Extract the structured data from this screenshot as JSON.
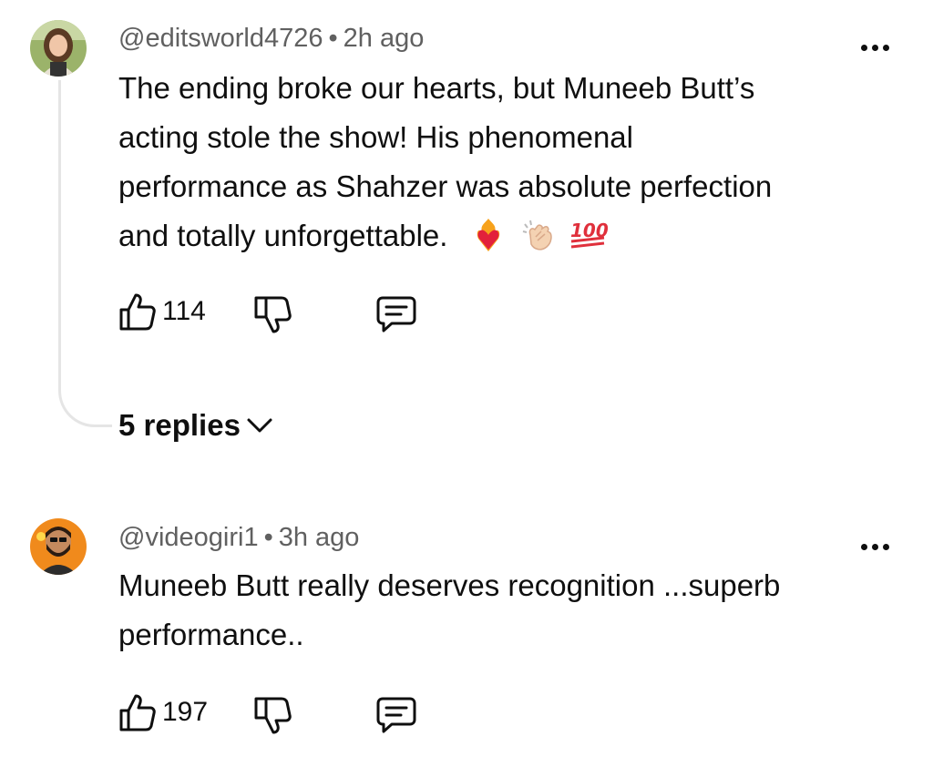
{
  "comments": [
    {
      "handle": "@editsworld4726",
      "time": "2h ago",
      "text_lines": [
        "The ending broke our hearts, but Muneeb Butt’s",
        "acting stole the show! His phenomenal",
        "performance as Shahzer was absolute perfection",
        "and totally unforgettable."
      ],
      "emojis": [
        "heart-on-fire-icon",
        "clapping-hands-icon",
        "hundred-points-icon"
      ],
      "likes": "114",
      "replies_label": "5 replies",
      "colors": {
        "avatar_bg": "#9bb36a"
      }
    },
    {
      "handle": "@videogiri1",
      "time": "3h ago",
      "text_lines": [
        "Muneeb Butt really deserves recognition ...superb",
        "performance.."
      ],
      "likes": "197",
      "colors": {
        "avatar_bg": "#f08a1c"
      }
    }
  ],
  "separator": "•"
}
